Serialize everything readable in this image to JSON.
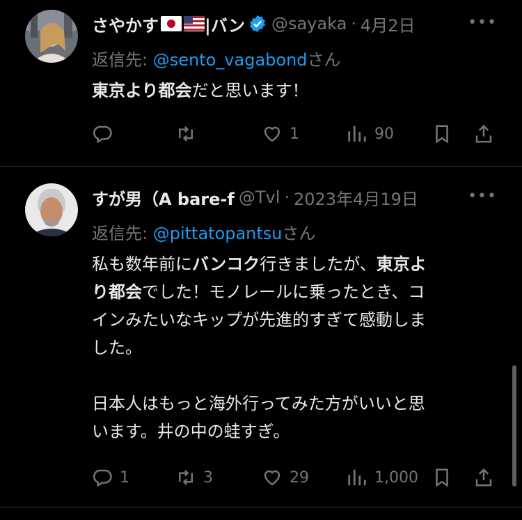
{
  "tweets": [
    {
      "name": "さやかす",
      "name_suffix": "|バン",
      "handle": "@sayaka",
      "dot": "·",
      "date": "4月2日",
      "reply_prefix": "返信先: ",
      "reply_to": "@sento_vagabond",
      "reply_suffix": "さん",
      "body": {
        "line1_bold": "東京より都会",
        "line1_rest": "だと思います！"
      },
      "stats": {
        "replies": "",
        "retweets": "",
        "likes": "1",
        "views": "90"
      }
    },
    {
      "name": "すが男（A bare-f",
      "handle": "@Tvl",
      "dot": "·",
      "date": "2023年4月19日",
      "reply_prefix": "返信先: ",
      "reply_to": "@pittatopantsu",
      "reply_suffix": "さん",
      "body": {
        "p1a": "私も数年前に",
        "p1b_bold": "バンコク",
        "p1c": "行きましたが、",
        "p1d_bold": "東京よ",
        "p1e_bold": "り都会",
        "p1f": "でした！モノレールに乗ったとき、コ",
        "p1g": "インみたいなキップが先進的すぎて感動しま",
        "p1h": "した。",
        "p2a": "日本人はもっと海外行ってみた方がいいと思",
        "p2b": "います。井の中の蛙すぎ。"
      },
      "stats": {
        "replies": "1",
        "retweets": "3",
        "likes": "29",
        "views": "1,000"
      }
    }
  ],
  "more_label": "•••",
  "colors": {
    "bg": "#000000",
    "text": "#e7e9ea",
    "muted": "#71767b",
    "link": "#1d9bf0",
    "divider": "#2f3336"
  },
  "icons": [
    "reply-icon",
    "retweet-icon",
    "like-icon",
    "views-icon",
    "bookmark-icon",
    "share-icon",
    "verified-icon",
    "more-icon"
  ]
}
